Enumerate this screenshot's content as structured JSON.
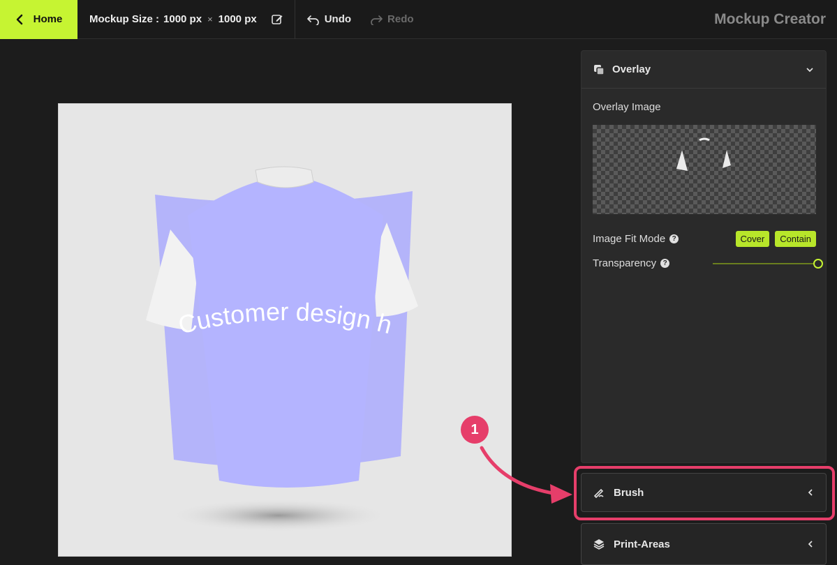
{
  "topbar": {
    "home_label": "Home",
    "size_label": "Mockup Size :",
    "width_value": "1000 px",
    "times": "×",
    "height_value": "1000 px",
    "undo_label": "Undo",
    "redo_label": "Redo",
    "app_title": "Mockup Creator"
  },
  "canvas": {
    "design_text": "Customer design here"
  },
  "panel": {
    "title": "Overlay",
    "overlay_image_label": "Overlay Image",
    "fit_mode_label": "Image Fit Mode",
    "fit_options": [
      "Cover",
      "Contain"
    ],
    "transparency_label": "Transparency",
    "transparency_value": 1.0
  },
  "accordions": {
    "brush_label": "Brush",
    "print_areas_label": "Print-Areas"
  },
  "annotation": {
    "step_number": "1"
  },
  "colors": {
    "accent": "#c6f432",
    "highlight": "#e63e6a",
    "overlay": "#a7a7ff"
  }
}
